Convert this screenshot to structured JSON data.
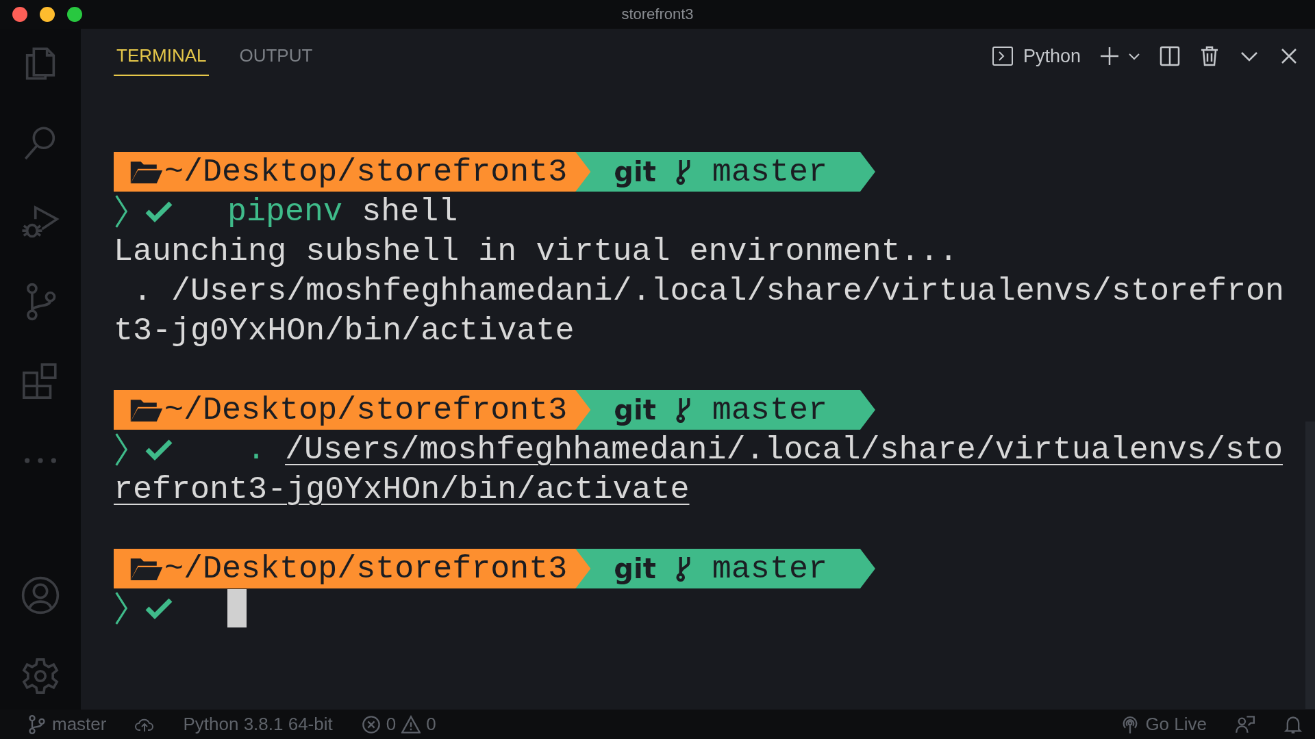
{
  "window": {
    "title": "storefront3"
  },
  "tabs": [
    {
      "label": "TERMINAL",
      "selected": true
    },
    {
      "label": "OUTPUT",
      "selected": false
    }
  ],
  "toolbar": {
    "shell": "Python"
  },
  "terminal": {
    "lines": [
      {
        "kind": "prompt",
        "path": "~/Desktop/storefront3",
        "vcs": "git",
        "branch": "master"
      },
      {
        "kind": "command",
        "program": "pipenv",
        "args": " shell"
      },
      {
        "kind": "output",
        "text": "Launching subshell in virtual environment...",
        "underlined": false
      },
      {
        "kind": "output",
        "text": " . /Users/moshfeghhamedani/.local/share/virtualenvs/storefron",
        "underlined": false
      },
      {
        "kind": "output",
        "text": "t3-jg0YxHOn/bin/activate",
        "underlined": false
      },
      {
        "kind": "blank"
      },
      {
        "kind": "prompt",
        "path": "~/Desktop/storefront3",
        "vcs": "git",
        "branch": "master"
      },
      {
        "kind": "command",
        "program": " .",
        "link": "/Users/moshfeghhamedani/.local/share/virtualenvs/sto"
      },
      {
        "kind": "output",
        "text": "refront3-jg0YxHOn/bin/activate",
        "underlined": true
      },
      {
        "kind": "blank"
      },
      {
        "kind": "prompt",
        "path": "~/Desktop/storefront3",
        "vcs": "git",
        "branch": "master"
      },
      {
        "kind": "cursor"
      }
    ]
  },
  "status_bar": {
    "branch": "master",
    "interpreter": "Python 3.8.1 64-bit",
    "errors": "0",
    "warnings": "0",
    "live": "Go Live"
  }
}
